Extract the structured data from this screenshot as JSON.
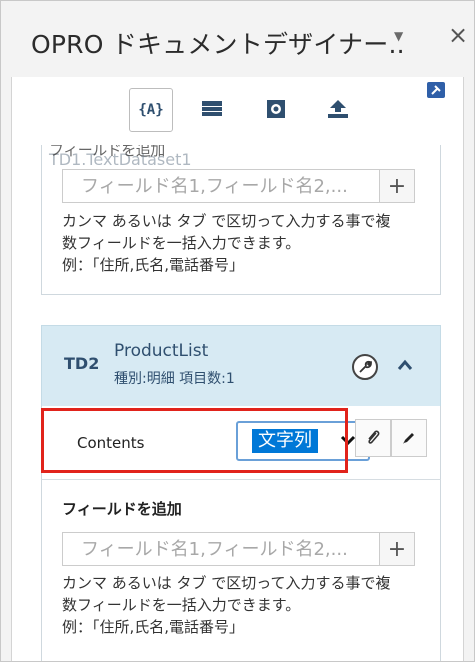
{
  "window": {
    "title": "OPRO ドキュメントデザイナー..",
    "menu_icon": "caret-down-icon",
    "close_label": "×"
  },
  "toolbar": {
    "tabs": [
      {
        "name": "variables",
        "icon": "curly-braces-icon",
        "label": "{A}",
        "active": true
      },
      {
        "name": "table",
        "icon": "table-icon"
      },
      {
        "name": "settings",
        "icon": "gear-icon"
      },
      {
        "name": "upload",
        "icon": "upload-icon"
      }
    ],
    "pin_icon": "pin-icon"
  },
  "dataset1": {
    "label": "TD1.TextDataset1",
    "add_field_heading": "フィールドを追加",
    "input_placeholder": "フィールド名1,フィールド名2,...",
    "add_button": "+",
    "help_lines": [
      "カンマ あるいは タブ で区切って入力する事で複",
      "数フィールドを一括入力できます。",
      "例：「住所,氏名,電話番号」"
    ]
  },
  "dataset2": {
    "badge": "TD2",
    "name": "ProductList",
    "meta": "種別:明細 項目数:1",
    "settings_icon": "wrench-icon",
    "collapse_icon": "chevron-up-icon",
    "field": {
      "name": "Contents",
      "type_value": "文字列",
      "attach_icon": "paperclip-icon",
      "edit_icon": "pencil-icon"
    },
    "add_field_heading": "フィールドを追加",
    "input_placeholder": "フィールド名1,フィールド名2,...",
    "add_button": "+",
    "help_lines": [
      "カンマ あるいは タブ で区切って入力する事で複",
      "数フィールドを一括入力できます。",
      "例：「住所,氏名,電話番号」"
    ]
  },
  "colors": {
    "accent": "#0078d7",
    "highlight": "#e1231b",
    "header_bg": "#d7eaf3"
  }
}
